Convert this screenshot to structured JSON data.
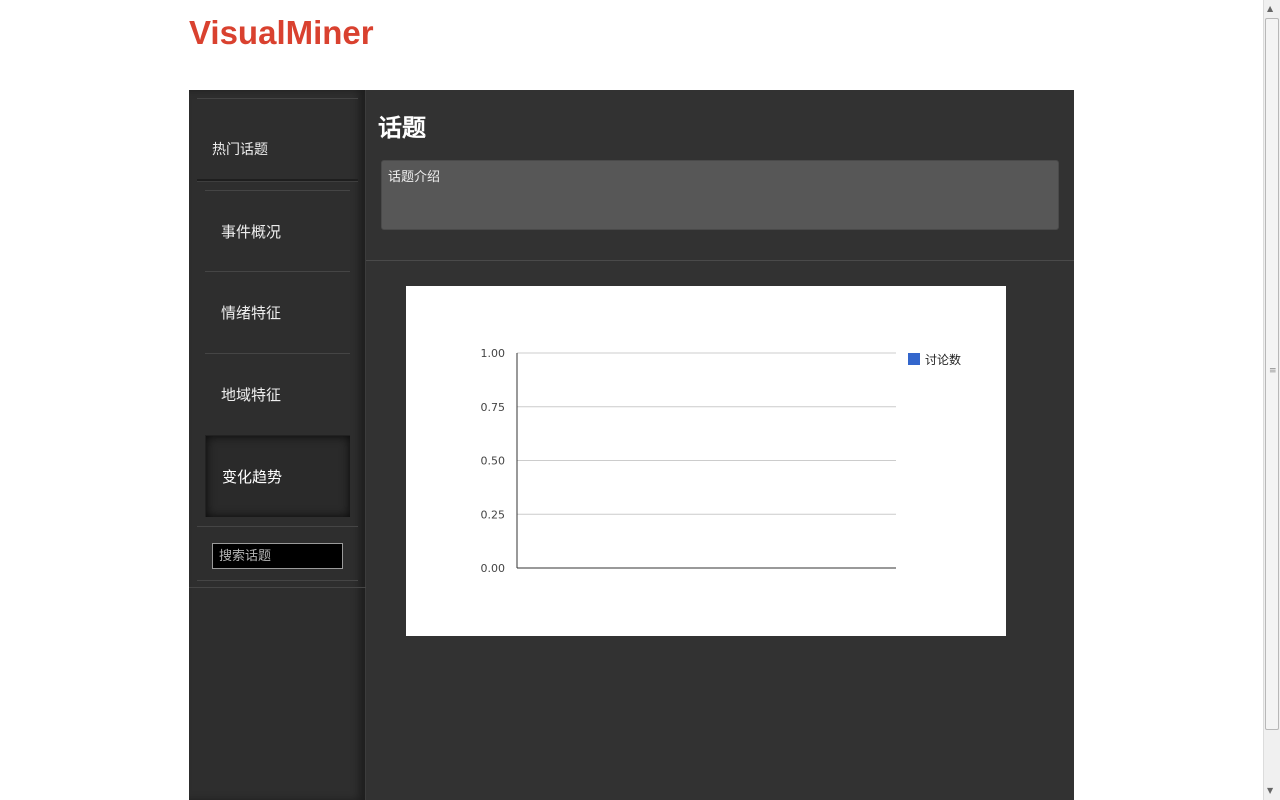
{
  "app": {
    "logo": "VisualMiner",
    "brand_color": "#d9412f"
  },
  "sidebar": {
    "header_label": "热门话题",
    "items": [
      {
        "label": "事件概况",
        "active": false
      },
      {
        "label": "情绪特征",
        "active": false
      },
      {
        "label": "地域特征",
        "active": false
      },
      {
        "label": "变化趋势",
        "active": true
      }
    ],
    "search": {
      "placeholder": "搜索话题",
      "value": ""
    }
  },
  "main": {
    "title": "话题",
    "intro": "话题介绍"
  },
  "chart_data": {
    "type": "line",
    "title": "",
    "xlabel": "",
    "ylabel": "",
    "ylim": [
      0,
      1
    ],
    "y_ticks": [
      "1.00",
      "0.75",
      "0.50",
      "0.25",
      "0.00"
    ],
    "grid": true,
    "legend_position": "right",
    "series": [
      {
        "name": "讨论数",
        "color": "#3366cc",
        "values": []
      }
    ]
  },
  "colors": {
    "panel_bg": "#323232",
    "sidebar_bg": "#2e2e2e",
    "intro_bg": "#575757"
  }
}
